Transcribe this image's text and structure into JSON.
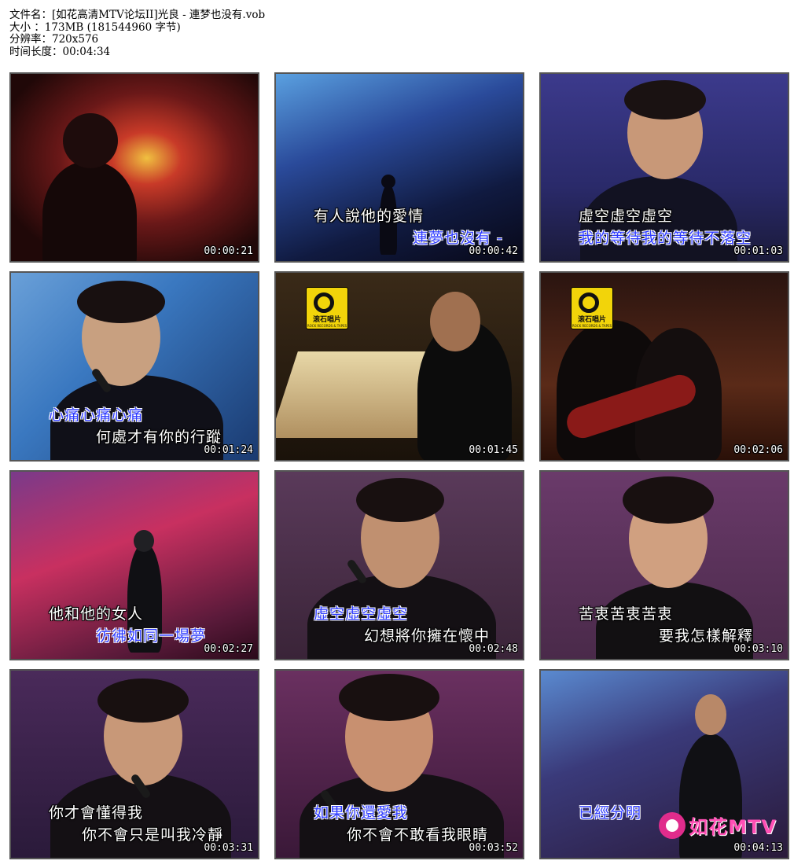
{
  "file_info": {
    "filename_label": "文件名：",
    "filename_value": "[如花高清MTV论坛II]光良 - 連梦也没有.vob",
    "size_label": "大小 ：",
    "size_value": "173MB (181544960 字节)",
    "resolution_label": "分辨率：",
    "resolution_value": "720x576",
    "duration_label": "时间长度：",
    "duration_value": "00:04:34"
  },
  "frames": [
    {
      "timestamp": "00:00:21",
      "lyric1": "",
      "lyric2": ""
    },
    {
      "timestamp": "00:00:42",
      "lyric1": "有人說他的愛情",
      "lyric2": "連夢也沒有 -"
    },
    {
      "timestamp": "00:01:03",
      "lyric1": "虛空虛空虛空",
      "lyric2": "我的等待我的等待不落空"
    },
    {
      "timestamp": "00:01:24",
      "lyric1": "心痛心痛心痛",
      "lyric2": "何處才有你的行蹤"
    },
    {
      "timestamp": "00:01:45",
      "lyric1": "",
      "lyric2": "",
      "logo": "滚石唱片",
      "logo_sub": "ROCK RECORDS & TAPES"
    },
    {
      "timestamp": "00:02:06",
      "lyric1": "",
      "lyric2": "",
      "logo": "滚石唱片",
      "logo_sub": "ROCK RECORDS & TAPES"
    },
    {
      "timestamp": "00:02:27",
      "lyric1": "他和他的女人",
      "lyric2": "彷彿如同一場夢"
    },
    {
      "timestamp": "00:02:48",
      "lyric1": "虛空虛空虛空",
      "lyric2": "幻想將你擁在懷中"
    },
    {
      "timestamp": "00:03:10",
      "lyric1": "苦衷苦衷苦衷",
      "lyric2": "要我怎樣解釋"
    },
    {
      "timestamp": "00:03:31",
      "lyric1": "你才會懂得我",
      "lyric2": "你不會只是叫我冷靜"
    },
    {
      "timestamp": "00:03:52",
      "lyric1": "如果你還愛我",
      "lyric2": "你不會不敢看我眼睛"
    },
    {
      "timestamp": "00:04:13",
      "lyric1": "已經分明",
      "lyric2": "",
      "watermark": "如花MTV"
    }
  ]
}
